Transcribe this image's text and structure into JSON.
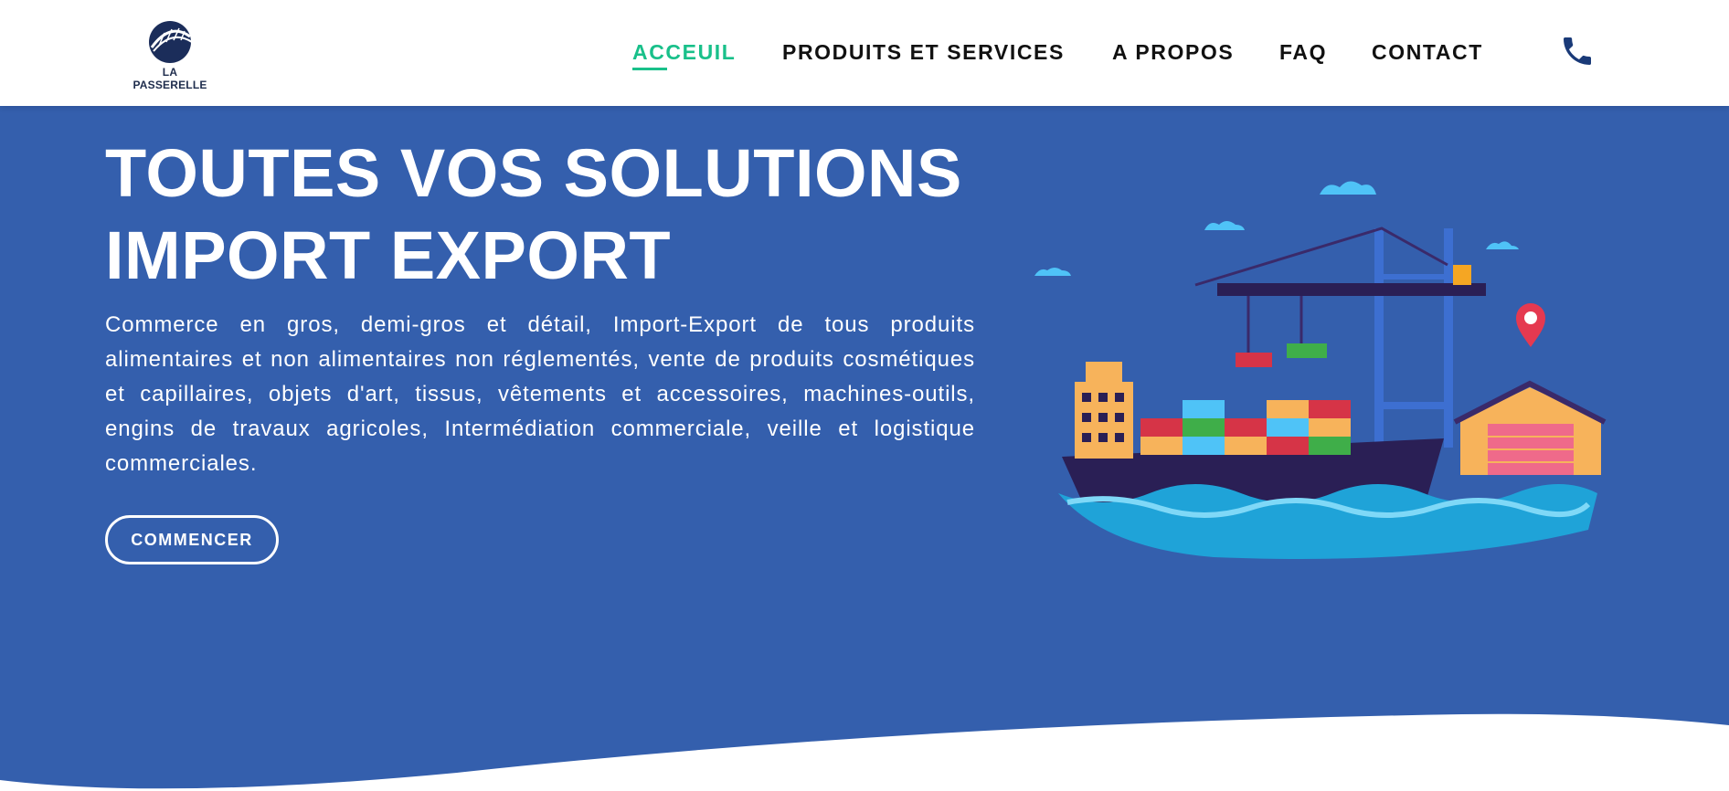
{
  "brand": {
    "name": "LA PASSERELLE"
  },
  "nav": {
    "items": [
      {
        "label": "ACCEUIL",
        "active": true
      },
      {
        "label": "PRODUITS ET SERVICES",
        "active": false
      },
      {
        "label": "A PROPOS",
        "active": false
      },
      {
        "label": "FAQ",
        "active": false
      },
      {
        "label": "CONTACT",
        "active": false
      }
    ],
    "phone_icon": "phone-icon"
  },
  "hero": {
    "title_line1": "TOUTES VOS SOLUTIONS",
    "title_line2": "IMPORT EXPORT",
    "description": "Commerce en gros, demi-gros et détail, Import-Export de tous produits alimentaires et non alimentaires non réglementés, vente de produits cosmétiques et capillaires, objets d'art, tissus, vêtements et accessoires, machines-outils, engins de travaux agricoles, Intermédiation commerciale, veille et logistique commerciales.",
    "cta_label": "COMMENCER"
  },
  "colors": {
    "hero_bg": "#345fad",
    "accent": "#19c08a",
    "nav_text": "#111111",
    "phone": "#1a3a78"
  }
}
